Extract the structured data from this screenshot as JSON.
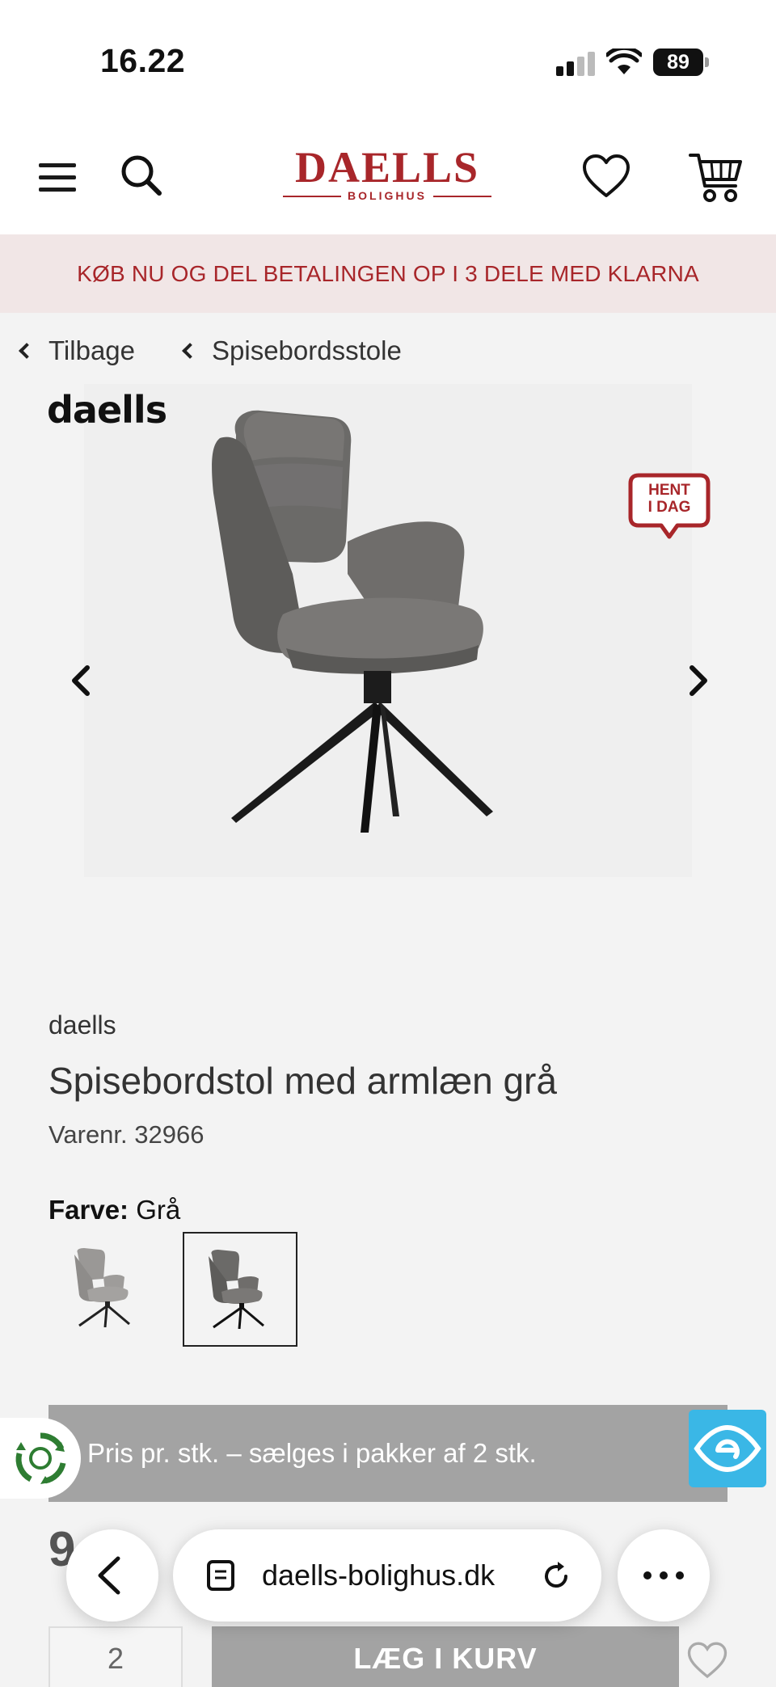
{
  "status_bar": {
    "time": "16.22",
    "battery": "89"
  },
  "header": {
    "logo_main": "DAELLS",
    "logo_sub": "BOLIGHUS",
    "brand_color": "#a8262a",
    "icons": [
      "hamburger-menu-icon",
      "search-icon",
      "heart-icon",
      "shopping-cart-icon"
    ]
  },
  "banner": {
    "text": "KØB NU OG DEL BETALINGEN OP I 3 DELE MED KLARNA"
  },
  "breadcrumb": {
    "back_label": "Tilbage",
    "category_label": "Spisebordsstole"
  },
  "gallery": {
    "brand_logo": "daells",
    "badge_line1": "HENT",
    "badge_line2": "I DAG"
  },
  "product": {
    "brand": "daells",
    "title": "Spisebordstol med armlæn grå",
    "sku": "Varenr. 32966",
    "color_label": "Farve:",
    "color_value": "Grå",
    "price_partial": "9",
    "price_note": "Pris pr. stk. – sælges i pakker af 2 stk.",
    "quantity": "2",
    "add_to_cart": "LÆG I KURV"
  },
  "browser": {
    "url": "daells-bolighus.dk"
  },
  "colors": {
    "banner_bg": "#f1e6e6",
    "disabled_gray": "#a3a3a3",
    "accessibility_blue": "#3ab7e6"
  }
}
